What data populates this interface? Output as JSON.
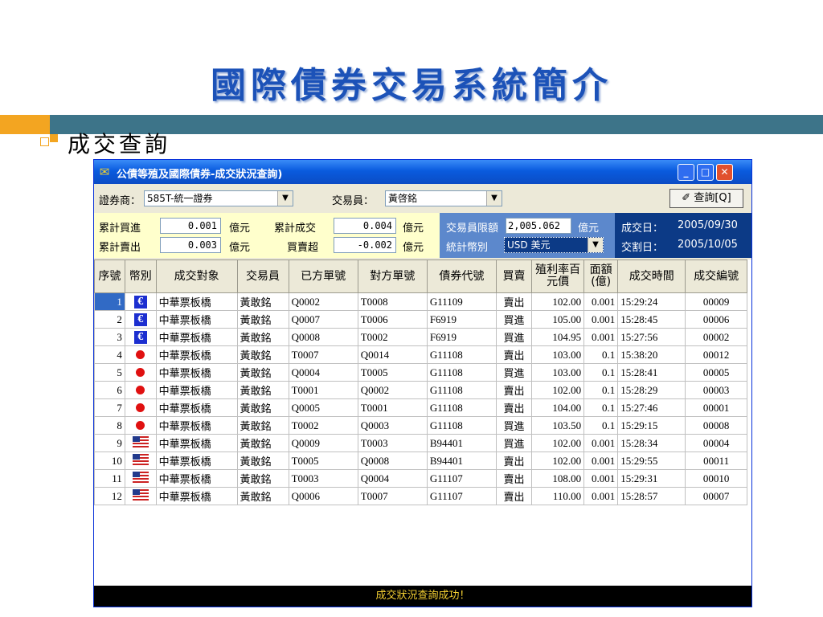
{
  "slide": {
    "title": "國際債券交易系統簡介",
    "bullet": "成交查詢"
  },
  "window": {
    "title": "公債等殖及國際債券-成交狀況查詢)",
    "min_label": "_",
    "max_label": "□",
    "close_label": "✕"
  },
  "toolbar": {
    "broker_label": "證券商：",
    "broker_value": "585T-統一證券",
    "trader_label": "交易員：",
    "trader_value": "黃啓銘",
    "query_label": "查詢[Q]"
  },
  "summary": {
    "buy_label": "累計買進",
    "buy_value": "0.001",
    "buy_unit": "億元",
    "sell_label": "累計賣出",
    "sell_value": "0.003",
    "sell_unit": "億元",
    "deal_label": "累計成交",
    "deal_value": "0.004",
    "deal_unit": "億元",
    "oversell_label": "買賣超",
    "oversell_value": "-0.002",
    "oversell_unit": "億元",
    "limit_label": "交易員限額",
    "limit_value": "2,005.062",
    "limit_unit": "億元",
    "currency_label": "統計幣別",
    "currency_value": "USD 美元",
    "trade_date_label": "成交日：",
    "trade_date": "2005/09/30",
    "settle_date_label": "交割日：",
    "settle_date": "2005/10/05"
  },
  "table": {
    "headers": [
      "序號",
      "幣別",
      "成交對象",
      "交易員",
      "已方單號",
      "對方單號",
      "債券代號",
      "買賣",
      "殖利率百元價",
      "面額(億)",
      "成交時間",
      "成交編號"
    ],
    "rows": [
      {
        "seq": "1",
        "cur": "euro",
        "counterparty": "中華票板橋",
        "trader": "黃敢銘",
        "own": "Q0002",
        "other": "T0008",
        "bond": "G11109",
        "side": "賣出",
        "price": "102.00",
        "face": "0.001",
        "time": "15:29:24",
        "no": "00009"
      },
      {
        "seq": "2",
        "cur": "euro",
        "counterparty": "中華票板橋",
        "trader": "黃敢銘",
        "own": "Q0007",
        "other": "T0006",
        "bond": "F6919",
        "side": "買進",
        "price": "105.00",
        "face": "0.001",
        "time": "15:28:45",
        "no": "00006"
      },
      {
        "seq": "3",
        "cur": "euro",
        "counterparty": "中華票板橋",
        "trader": "黃敢銘",
        "own": "Q0008",
        "other": "T0002",
        "bond": "F6919",
        "side": "買進",
        "price": "104.95",
        "face": "0.001",
        "time": "15:27:56",
        "no": "00002"
      },
      {
        "seq": "4",
        "cur": "jpy",
        "counterparty": "中華票板橋",
        "trader": "黃敢銘",
        "own": "T0007",
        "other": "Q0014",
        "bond": "G11108",
        "side": "賣出",
        "price": "103.00",
        "face": "0.1",
        "time": "15:38:20",
        "no": "00012"
      },
      {
        "seq": "5",
        "cur": "jpy",
        "counterparty": "中華票板橋",
        "trader": "黃敢銘",
        "own": "Q0004",
        "other": "T0005",
        "bond": "G11108",
        "side": "買進",
        "price": "103.00",
        "face": "0.1",
        "time": "15:28:41",
        "no": "00005"
      },
      {
        "seq": "6",
        "cur": "jpy",
        "counterparty": "中華票板橋",
        "trader": "黃敢銘",
        "own": "T0001",
        "other": "Q0002",
        "bond": "G11108",
        "side": "賣出",
        "price": "102.00",
        "face": "0.1",
        "time": "15:28:29",
        "no": "00003"
      },
      {
        "seq": "7",
        "cur": "jpy",
        "counterparty": "中華票板橋",
        "trader": "黃敢銘",
        "own": "Q0005",
        "other": "T0001",
        "bond": "G11108",
        "side": "賣出",
        "price": "104.00",
        "face": "0.1",
        "time": "15:27:46",
        "no": "00001"
      },
      {
        "seq": "8",
        "cur": "jpy",
        "counterparty": "中華票板橋",
        "trader": "黃敢銘",
        "own": "T0002",
        "other": "Q0003",
        "bond": "G11108",
        "side": "買進",
        "price": "103.50",
        "face": "0.1",
        "time": "15:29:15",
        "no": "00008"
      },
      {
        "seq": "9",
        "cur": "usd",
        "counterparty": "中華票板橋",
        "trader": "黃敢銘",
        "own": "Q0009",
        "other": "T0003",
        "bond": "B94401",
        "side": "買進",
        "price": "102.00",
        "face": "0.001",
        "time": "15:28:34",
        "no": "00004"
      },
      {
        "seq": "10",
        "cur": "usd",
        "counterparty": "中華票板橋",
        "trader": "黃敢銘",
        "own": "T0005",
        "other": "Q0008",
        "bond": "B94401",
        "side": "賣出",
        "price": "102.00",
        "face": "0.001",
        "time": "15:29:55",
        "no": "00011"
      },
      {
        "seq": "11",
        "cur": "usd",
        "counterparty": "中華票板橋",
        "trader": "黃敢銘",
        "own": "T0003",
        "other": "Q0004",
        "bond": "G11107",
        "side": "賣出",
        "price": "108.00",
        "face": "0.001",
        "time": "15:29:31",
        "no": "00010"
      },
      {
        "seq": "12",
        "cur": "usd",
        "counterparty": "中華票板橋",
        "trader": "黃敢銘",
        "own": "Q0006",
        "other": "T0007",
        "bond": "G11107",
        "side": "賣出",
        "price": "110.00",
        "face": "0.001",
        "time": "15:28:57",
        "no": "00007"
      }
    ]
  },
  "status": "成交狀況查詢成功！",
  "colors": {
    "title_blue": "#1c52b8",
    "deco_teal": "#3d7489",
    "deco_orange": "#f3a521",
    "titlebar_blue": "#0a5bde",
    "status_text": "#f5d032"
  }
}
